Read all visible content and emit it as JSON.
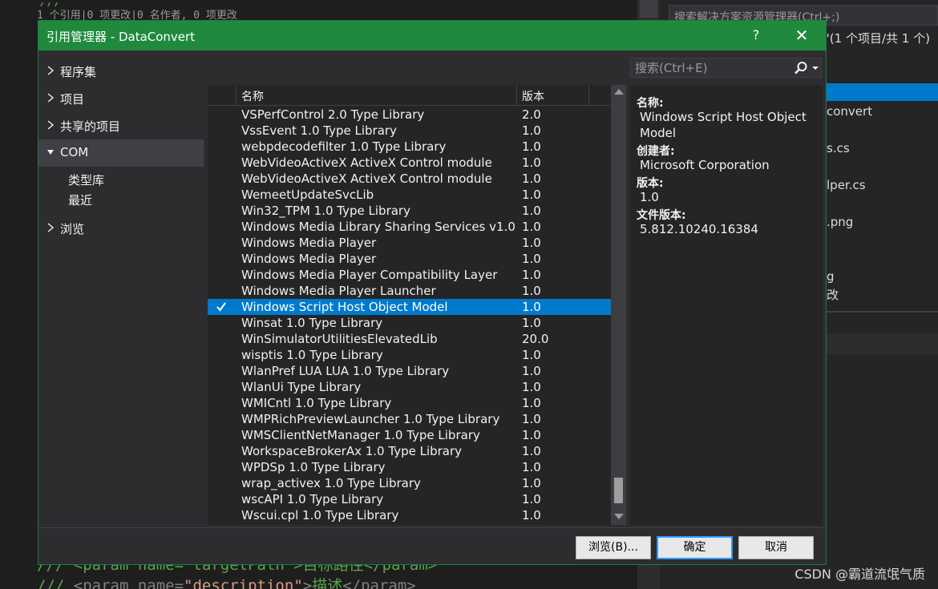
{
  "background": {
    "codelens": "1 个引用|0 项更改|0 名作者, 0 项更改",
    "code_top": "///  <param name=\"targetPath\">目标路径</param>",
    "code_bottom": {
      "prefix": "/// ",
      "tag_open": "<param",
      "attr": " name=",
      "str": "\"description\"",
      "gt": ">",
      "text": "描述",
      "tag_close": "</param>"
    },
    "explorer_search": "搜索解决方案资源管理器(Ctrl+;)",
    "explorer_items": [
      "t\"(1 个项目/共 1 个)",
      "convert",
      "s.cs",
      "lper.cs",
      ".png",
      "g",
      "改"
    ],
    "watermark": "CSDN @霸道流氓气质"
  },
  "dialog": {
    "title": "引用管理器 - DataConvert",
    "help": "?",
    "close": "✕"
  },
  "nav": {
    "items": [
      {
        "label": "程序集"
      },
      {
        "label": "项目"
      },
      {
        "label": "共享的项目"
      },
      {
        "label": "COM"
      },
      {
        "label": "浏览"
      }
    ],
    "sub_items": [
      "类型库",
      "最近"
    ]
  },
  "list": {
    "columns": {
      "name": "名称",
      "version": "版本"
    },
    "rows": [
      {
        "name": "VSPerfControl 2.0 Type Library",
        "version": "2.0"
      },
      {
        "name": "VssEvent 1.0 Type Library",
        "version": "1.0"
      },
      {
        "name": "webpdecodefilter 1.0 Type Library",
        "version": "1.0"
      },
      {
        "name": "WebVideoActiveX ActiveX Control module",
        "version": "1.0"
      },
      {
        "name": "WebVideoActiveX ActiveX Control module",
        "version": "1.0"
      },
      {
        "name": "WemeetUpdateSvcLib",
        "version": "1.0"
      },
      {
        "name": "Win32_TPM 1.0 Type Library",
        "version": "1.0"
      },
      {
        "name": "Windows Media Library Sharing Services v1.0",
        "version": "1.0"
      },
      {
        "name": "Windows Media Player",
        "version": "1.0"
      },
      {
        "name": "Windows Media Player",
        "version": "1.0"
      },
      {
        "name": "Windows Media Player Compatibility Layer",
        "version": "1.0"
      },
      {
        "name": "Windows Media Player Launcher",
        "version": "1.0"
      },
      {
        "name": "Windows Script Host Object Model",
        "version": "1.0"
      },
      {
        "name": "Winsat 1.0 Type Library",
        "version": "1.0"
      },
      {
        "name": "WinSimulatorUtilitiesElevatedLib",
        "version": "20.0"
      },
      {
        "name": "wisptis 1.0 Type Library",
        "version": "1.0"
      },
      {
        "name": "WlanPref LUA LUA 1.0 Type Library",
        "version": "1.0"
      },
      {
        "name": "WlanUi Type Library",
        "version": "1.0"
      },
      {
        "name": "WMICntl 1.0 Type Library",
        "version": "1.0"
      },
      {
        "name": "WMPRichPreviewLauncher 1.0 Type Library",
        "version": "1.0"
      },
      {
        "name": "WMSClientNetManager 1.0 Type Library",
        "version": "1.0"
      },
      {
        "name": "WorkspaceBrokerAx 1.0 Type Library",
        "version": "1.0"
      },
      {
        "name": "WPDSp 1.0 Type Library",
        "version": "1.0"
      },
      {
        "name": "wrap_activex 1.0 Type Library",
        "version": "1.0"
      },
      {
        "name": "wscAPI 1.0 Type Library",
        "version": "1.0"
      },
      {
        "name": "Wscui.cpl 1.0 Type Library",
        "version": "1.0"
      }
    ],
    "selected_index": 12
  },
  "search": {
    "placeholder": "搜索(Ctrl+E)"
  },
  "details": {
    "name_label": "名称:",
    "name_value": "Windows Script Host Object Model",
    "creator_label": "创建者:",
    "creator_value": "Microsoft Corporation",
    "version_label": "版本:",
    "version_value": "1.0",
    "file_version_label": "文件版本:",
    "file_version_value": "5.812.10240.16384"
  },
  "buttons": {
    "browse": "浏览(B)...",
    "ok": "确定",
    "cancel": "取消"
  },
  "icons": {
    "nav_arrow": "triangle-right-icon",
    "search": "search-icon",
    "check": "checkmark-icon"
  },
  "colors": {
    "title_bar": "#1f8a3e",
    "selection": "#007acc",
    "dialog_bg": "#2d2d30",
    "panel_bg": "#252526"
  }
}
